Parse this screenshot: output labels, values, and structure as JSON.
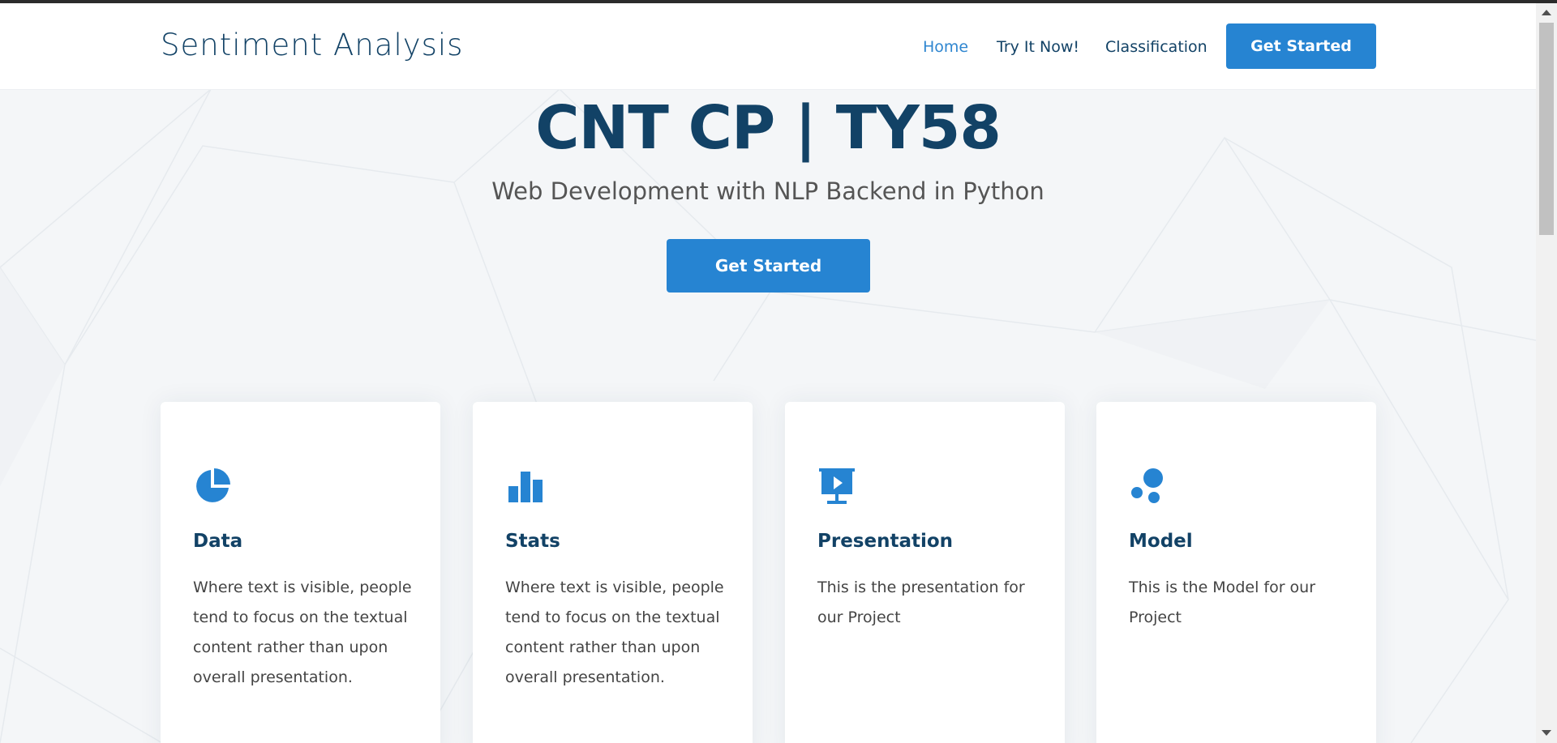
{
  "site": {
    "logo": "Sentiment Analysis"
  },
  "nav": {
    "items": [
      {
        "label": "Home",
        "active": true
      },
      {
        "label": "Try It Now!",
        "active": false
      },
      {
        "label": "Classification",
        "active": false
      }
    ],
    "cta_label": "Get Started"
  },
  "hero": {
    "title": "CNT CP | TY58",
    "subtitle": "Web Development with NLP Backend in Python",
    "cta_label": "Get Started"
  },
  "cards": [
    {
      "icon": "pie-chart-icon",
      "title": "Data",
      "text": "Where text is visible, people tend to focus on the textual content rather than upon overall presentation."
    },
    {
      "icon": "bar-chart-icon",
      "title": "Stats",
      "text": "Where text is visible, people tend to focus on the textual content rather than upon overall presentation."
    },
    {
      "icon": "presentation-icon",
      "title": "Presentation",
      "text": "This is the presentation for our Project"
    },
    {
      "icon": "bubbles-icon",
      "title": "Model",
      "text": "This is the Model for our Project"
    }
  ],
  "colors": {
    "brand": "#124266",
    "accent": "#2684d2",
    "nav_active": "#2f86d0"
  }
}
